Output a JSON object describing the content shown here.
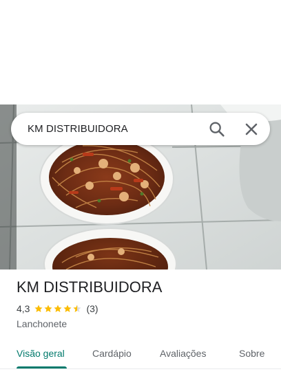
{
  "search": {
    "query": "KM DISTRIBUIDORA"
  },
  "place": {
    "name": "KM DISTRIBUIDORA",
    "rating": "4,3",
    "stars": 4.3,
    "review_count": "(3)",
    "category": "Lanchonete"
  },
  "tabs": [
    {
      "label": "Visão geral"
    },
    {
      "label": "Cardápio"
    },
    {
      "label": "Avaliações"
    },
    {
      "label": "Sobre"
    }
  ],
  "colors": {
    "accent": "#00796b",
    "star": "#fbbc04"
  },
  "icons": {
    "search": "search-icon",
    "close": "close-icon",
    "star": "star-icon"
  }
}
